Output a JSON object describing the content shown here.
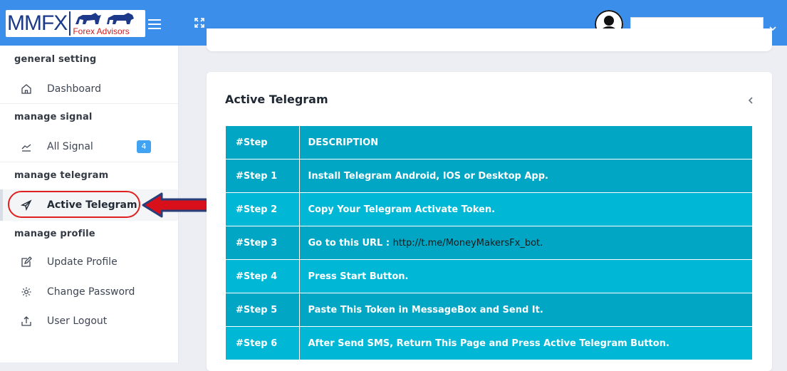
{
  "header": {
    "logo_text": "MMFX",
    "logo_sub": "Forex Advisors",
    "user_name": ""
  },
  "sidebar": {
    "sections": [
      {
        "title": "general setting",
        "items": [
          {
            "label": "Dashboard",
            "icon": "home-icon"
          }
        ]
      },
      {
        "title": "manage signal",
        "items": [
          {
            "label": "All Signal",
            "icon": "chart-line-icon",
            "badge": "4"
          }
        ]
      },
      {
        "title": "manage telegram",
        "items": [
          {
            "label": "Active Telegram",
            "icon": "paper-plane-icon"
          }
        ]
      },
      {
        "title": "manage profile",
        "items": [
          {
            "label": "Update Profile",
            "icon": "edit-icon"
          },
          {
            "label": "Change Password",
            "icon": "gear-icon"
          },
          {
            "label": "User Logout",
            "icon": "logout-icon"
          }
        ]
      }
    ]
  },
  "main": {
    "card_title": "Active Telegram",
    "table": {
      "headers": [
        "#Step",
        "DESCRIPTION"
      ],
      "rows": [
        {
          "step": "#Step 1",
          "desc": "Install Telegram Android, IOS or Desktop App."
        },
        {
          "step": "#Step 2",
          "desc": "Copy Your Telegram Activate Token."
        },
        {
          "step": "#Step 3",
          "desc": "Go to this URL : ",
          "url": "http://t.me/MoneyMakersFx_bot."
        },
        {
          "step": "#Step 4",
          "desc": "Press Start Button."
        },
        {
          "step": "#Step 5",
          "desc": "Paste This Token in MessageBox and Send It."
        },
        {
          "step": "#Step 6",
          "desc": "After Send SMS, Return This Page and Press Active Telegram Button."
        }
      ]
    }
  },
  "colors": {
    "header": "#3b8eea",
    "table_cell": "#00b8d6",
    "highlight": "#e02020",
    "badge": "#41a3f2"
  }
}
